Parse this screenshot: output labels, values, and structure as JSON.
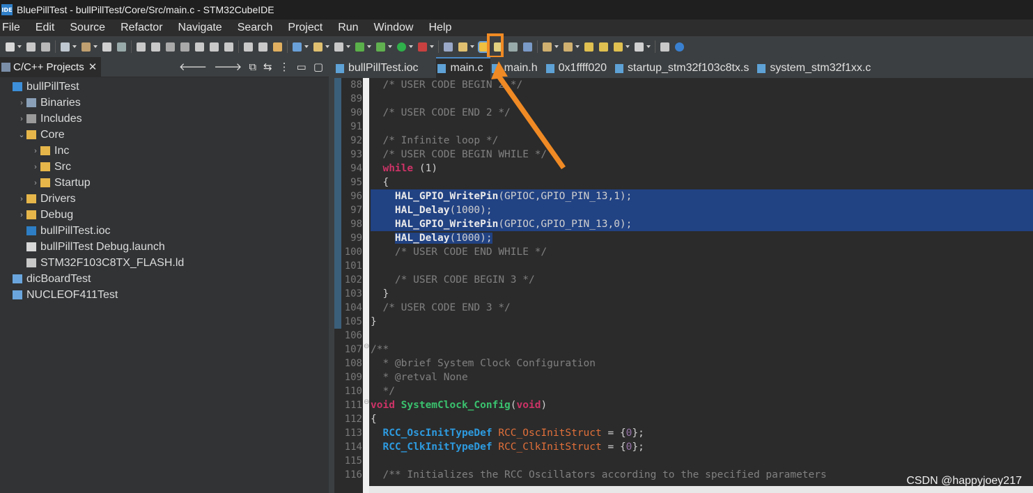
{
  "window": {
    "title": "BluePillTest - bullPillTest/Core/Src/main.c - STM32CubeIDE",
    "app_icon": "IDE"
  },
  "menu": [
    "File",
    "Edit",
    "Source",
    "Refactor",
    "Navigate",
    "Search",
    "Project",
    "Run",
    "Window",
    "Help"
  ],
  "left_panel": {
    "tab_label": "C/C++ Projects",
    "tree": [
      {
        "label": "bullPillTest",
        "icon": "project-icon",
        "indent": 0,
        "chevron": ""
      },
      {
        "label": "Binaries",
        "icon": "binaries-icon",
        "indent": 1,
        "chevron": "›"
      },
      {
        "label": "Includes",
        "icon": "includes-icon",
        "indent": 1,
        "chevron": "›"
      },
      {
        "label": "Core",
        "icon": "folder-icon",
        "indent": 1,
        "chevron": "⌄"
      },
      {
        "label": "Inc",
        "icon": "folder-icon",
        "indent": 2,
        "chevron": "›"
      },
      {
        "label": "Src",
        "icon": "folder-icon",
        "indent": 2,
        "chevron": "›"
      },
      {
        "label": "Startup",
        "icon": "folder-icon",
        "indent": 2,
        "chevron": "›"
      },
      {
        "label": "Drivers",
        "icon": "folder-icon",
        "indent": 1,
        "chevron": "›"
      },
      {
        "label": "Debug",
        "icon": "folder-icon",
        "indent": 1,
        "chevron": "›"
      },
      {
        "label": "bullPillTest.ioc",
        "icon": "mx-file-icon",
        "indent": 1,
        "chevron": ""
      },
      {
        "label": "bullPillTest Debug.launch",
        "icon": "file-icon",
        "indent": 1,
        "chevron": ""
      },
      {
        "label": "STM32F103C8TX_FLASH.ld",
        "icon": "ld-file-icon",
        "indent": 1,
        "chevron": ""
      },
      {
        "label": "dicBoardTest",
        "icon": "project-folder-icon",
        "indent": 0,
        "chevron": ""
      },
      {
        "label": "NUCLEOF411Test",
        "icon": "project-folder-icon",
        "indent": 0,
        "chevron": ""
      }
    ]
  },
  "editor_tabs": [
    {
      "label": "bullPillTest.ioc",
      "icon": "mx-file-icon",
      "active": false
    },
    {
      "label": "main.c",
      "icon": "c-file-icon",
      "active": true
    },
    {
      "label": "main.h",
      "icon": "h-file-icon",
      "active": false
    },
    {
      "label": "0x1ffff020",
      "icon": "c-file-icon",
      "active": false
    },
    {
      "label": "startup_stm32f103c8tx.s",
      "icon": "s-file-icon",
      "active": false
    },
    {
      "label": "system_stm32f1xx.c",
      "icon": "c-file-icon",
      "active": false
    }
  ],
  "code": {
    "line_numbers": [
      "88",
      "89",
      "90",
      "91",
      "92",
      "93",
      "94",
      "95",
      "96",
      "97",
      "98",
      "99",
      "100",
      "101",
      "102",
      "103",
      "104",
      "105",
      "106",
      "107",
      "108",
      "109",
      "110",
      "111",
      "112",
      "113",
      "114",
      "115",
      "116"
    ],
    "lines": [
      [
        "  /* USER CODE BEGIN 2 */"
      ],
      [
        ""
      ],
      [
        "  /* USER CODE END 2 */"
      ],
      [
        ""
      ],
      [
        "  /* Infinite loop */"
      ],
      [
        "  /* USER CODE BEGIN WHILE */"
      ],
      [
        "  ",
        "while",
        " (1)"
      ],
      [
        "  {"
      ],
      [
        "    ",
        "HAL_GPIO_WritePin",
        "(GPIOC,GPIO_PIN_13,1);"
      ],
      [
        "    ",
        "HAL_Delay",
        "(1000);"
      ],
      [
        "    ",
        "HAL_GPIO_WritePin",
        "(GPIOC,GPIO_PIN_13,0);"
      ],
      [
        "    ",
        "HAL_Delay",
        "(1000);"
      ],
      [
        "    /* USER CODE END WHILE */"
      ],
      [
        ""
      ],
      [
        "    /* USER CODE BEGIN 3 */"
      ],
      [
        "  }"
      ],
      [
        "  /* USER CODE END 3 */"
      ],
      [
        "}"
      ],
      [
        ""
      ],
      [
        "/**"
      ],
      [
        "  * @brief System Clock Configuration"
      ],
      [
        "  * @retval None"
      ],
      [
        "  */"
      ],
      [
        "void",
        " ",
        "SystemClock_Config",
        "(",
        "void",
        ")"
      ],
      [
        "{"
      ],
      [
        "  ",
        "RCC_OscInitTypeDef",
        " ",
        "RCC_OscInitStruct",
        " = {",
        "0",
        "};"
      ],
      [
        "  ",
        "RCC_ClkInitTypeDef",
        " ",
        "RCC_ClkInitStruct",
        " = {",
        "0",
        "};"
      ],
      [
        ""
      ],
      [
        "  /** Initializes the RCC Oscillators according to the specified parameters"
      ]
    ]
  },
  "watermark": "CSDN @happyjoey217",
  "colors": {
    "highlight_box": "#f08a24",
    "selection": "#214283"
  }
}
